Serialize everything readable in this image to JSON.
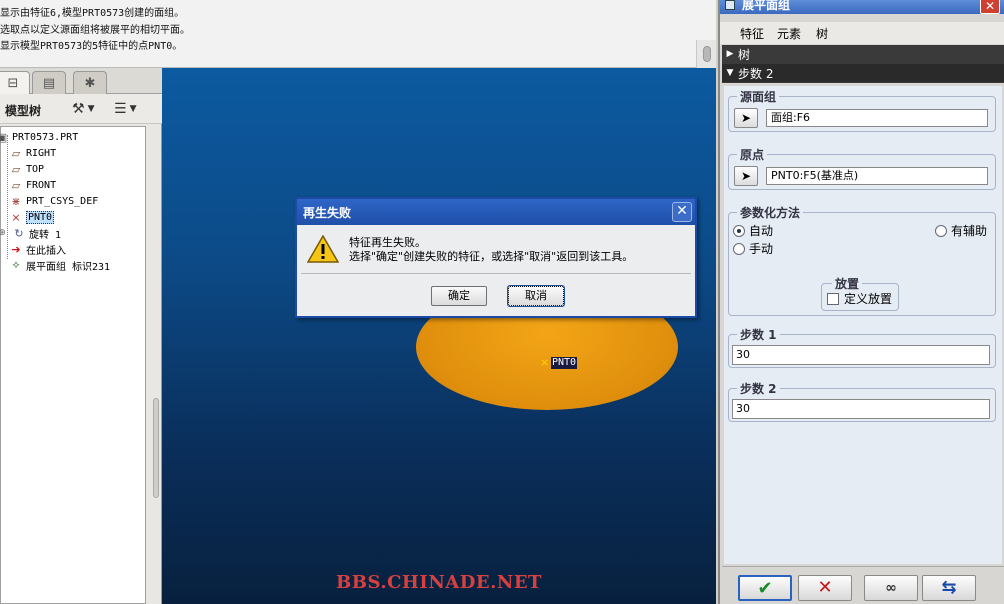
{
  "messages": [
    "显示由特征6,模型PRT0573创建的面组。",
    "选取点以定义源面组将被展平的相切平面。",
    "显示模型PRT0573的5特征中的点PNT0。"
  ],
  "model_tree": {
    "title": "模型树",
    "items": [
      {
        "label": "PRT0573.PRT",
        "icon": "part-icon"
      },
      {
        "label": "RIGHT",
        "icon": "datum-plane-icon"
      },
      {
        "label": "TOP",
        "icon": "datum-plane-icon"
      },
      {
        "label": "FRONT",
        "icon": "datum-plane-icon"
      },
      {
        "label": "PRT_CSYS_DEF",
        "icon": "csys-icon"
      },
      {
        "label": "PNT0",
        "icon": "datum-point-icon",
        "selected": true
      },
      {
        "label": "旋转 1",
        "icon": "revolve-icon"
      },
      {
        "label": "在此插入",
        "icon": "insert-arrow-icon"
      },
      {
        "label": "展平面组 标识231",
        "icon": "flatten-quilt-icon"
      }
    ]
  },
  "graphics": {
    "point_label": "PNT0",
    "watermark": "BBS.CHINADE.NET"
  },
  "dialog": {
    "title": "再生失败",
    "line1": "特征再生失败。",
    "line2": "选择\"确定\"创建失败的特征，或选择\"取消\"返回到该工具。",
    "ok_label": "确定",
    "cancel_label": "取消"
  },
  "right_panel": {
    "title": "展平面组",
    "menu": [
      "特征",
      "元素",
      "树"
    ],
    "nav_tree": "树",
    "nav_step": "步数 2",
    "source_quilt": {
      "title": "源面组",
      "value": "面组:F6"
    },
    "origin": {
      "title": "原点",
      "value": "PNT0:F5(基准点)"
    },
    "param_method": {
      "title": "参数化方法",
      "auto": "自动",
      "manual": "手动",
      "auxiliary": "有辅助",
      "selected": "自动"
    },
    "placement": {
      "title": "放置",
      "checkbox_label": "定义放置",
      "checked": false
    },
    "step1": {
      "title": "步数 1",
      "value": "30"
    },
    "step2": {
      "title": "步数 2",
      "value": "30"
    }
  },
  "colors": {
    "accent": "#1f4fa8",
    "ok_check": "#1a8a2a",
    "cancel_x": "#c01818"
  }
}
